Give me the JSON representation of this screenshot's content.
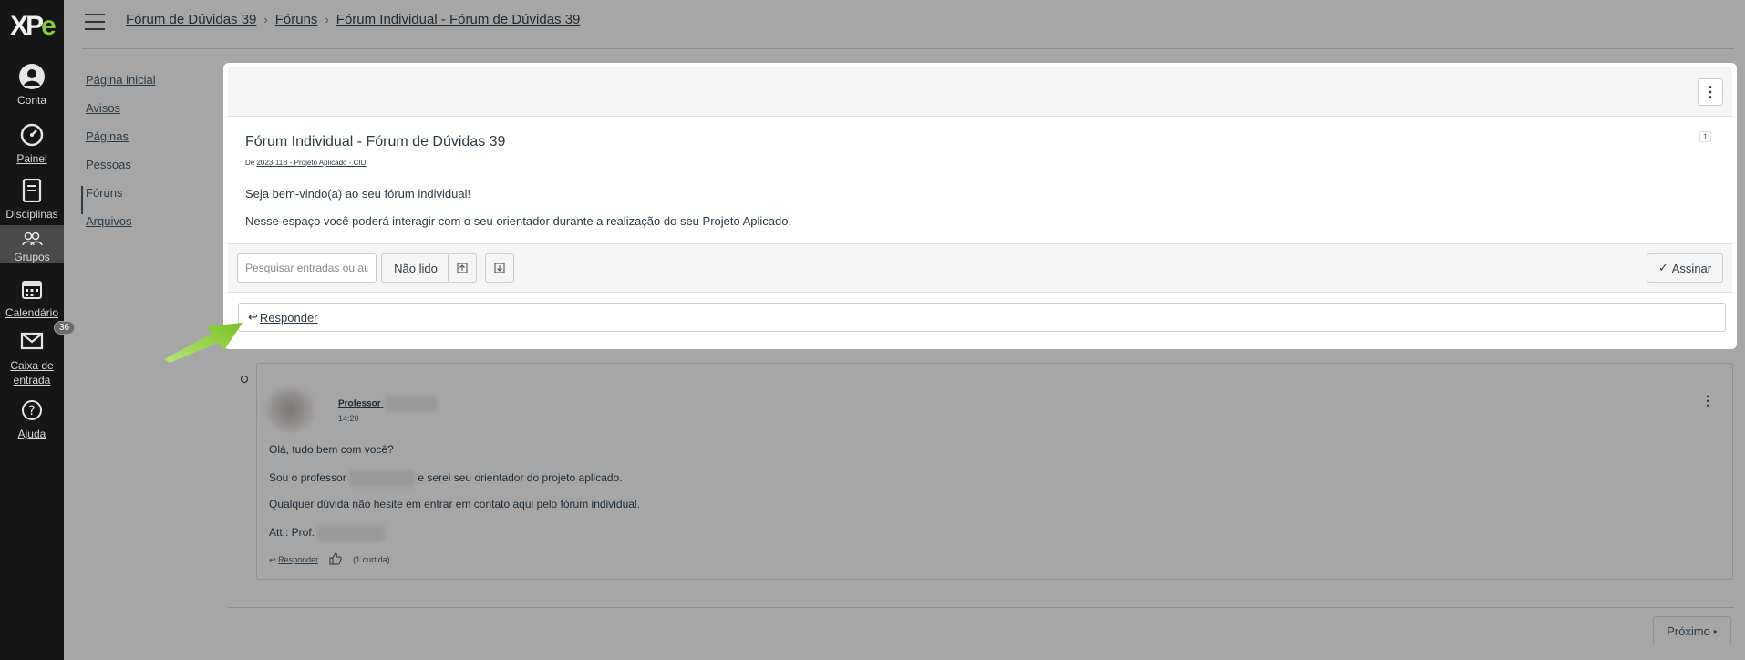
{
  "global_nav": {
    "logo": {
      "part1": "XP",
      "part2": "e"
    },
    "items": [
      {
        "label": "Conta",
        "icon": "user-icon"
      },
      {
        "label": "Painel",
        "icon": "dashboard-icon"
      },
      {
        "label": "Disciplinas",
        "icon": "book-icon"
      },
      {
        "label": "Grupos",
        "icon": "groups-icon"
      },
      {
        "label": "Calendário",
        "icon": "calendar-icon"
      },
      {
        "label": "Caixa de entrada",
        "icon": "inbox-icon",
        "badge": "36"
      },
      {
        "label": "Ajuda",
        "icon": "help-icon"
      }
    ]
  },
  "breadcrumbs": [
    "Fórum de Dúvidas 39",
    "Fóruns",
    "Fórum Individual - Fórum de Dúvidas 39"
  ],
  "course_nav": [
    "Página inicial",
    "Avisos",
    "Páginas",
    "Pessoas",
    "Fóruns",
    "Arquivos"
  ],
  "topic": {
    "title": "Fórum Individual - Fórum de Dúvidas 39",
    "from_prefix": "De",
    "from_link": "2023-11B - Projeto Aplicado - CID",
    "count": "1",
    "message_line1": "Seja bem-vindo(a) ao seu fórum individual!",
    "message_line2": "Nesse espaço você poderá interagir com o seu orientador durante a realização do seu Projeto Aplicado."
  },
  "toolbar": {
    "search_placeholder": "Pesquisar entradas ou autor",
    "unread_label": "Não lido",
    "subscribe_label": "Assinar"
  },
  "reply_label": "Responder",
  "entry": {
    "author": "Professor",
    "time": "14:20",
    "line1": "Olá, tudo bem com você?",
    "line2_a": "Sou o professor",
    "line2_b": "e serei seu orientador do projeto aplicado.",
    "line3": "Qualquer dúvida não hesite em entrar em contato aqui pelo fórum individual.",
    "line4": "Att.: Prof.",
    "reply_label": "Responder",
    "likes": "(1 curtida)"
  },
  "next_label": "Próximo",
  "colors": {
    "accent_arrow": "#8cc63f",
    "nav_bg": "#161616",
    "overlay": "#a6a6a6"
  }
}
